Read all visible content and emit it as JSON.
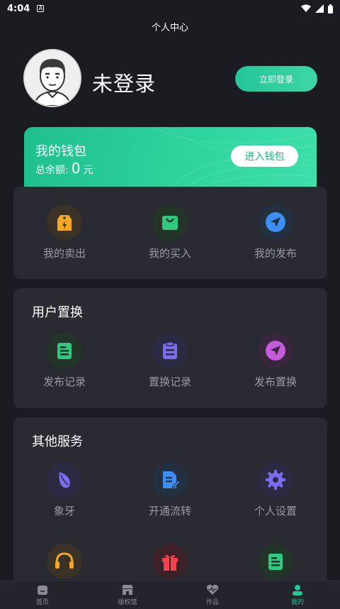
{
  "status": {
    "time": "4:04",
    "notification_icon": "A"
  },
  "header": {
    "title": "个人中心"
  },
  "profile": {
    "name": "未登录",
    "login_label": "立即登录"
  },
  "wallet": {
    "title": "我的钱包",
    "balance_label": "总余额:",
    "balance_value": "0",
    "balance_unit": "元",
    "enter_label": "进入钱包"
  },
  "orders": {
    "items": [
      {
        "label": "我的卖出",
        "icon": "price-tag-icon",
        "color": "#f5a623"
      },
      {
        "label": "我的买入",
        "icon": "shopping-bag-icon",
        "color": "#2ec97f"
      },
      {
        "label": "我的发布",
        "icon": "send-arrow-icon",
        "color": "#3d8ff5"
      }
    ]
  },
  "exchange": {
    "title": "用户置换",
    "items": [
      {
        "label": "发布记录",
        "icon": "document-icon",
        "color": "#2ec97f"
      },
      {
        "label": "置换记录",
        "icon": "clipboard-icon",
        "color": "#7b6cf0"
      },
      {
        "label": "发布置换",
        "icon": "send-arrow-icon",
        "color": "#c45bd9"
      }
    ]
  },
  "services": {
    "title": "其他服务",
    "items": [
      {
        "label": "象牙",
        "icon": "leaf-icon",
        "color": "#7b6cf0"
      },
      {
        "label": "开通流转",
        "icon": "edit-document-icon",
        "color": "#3d8ff5"
      },
      {
        "label": "个人设置",
        "icon": "gear-icon",
        "color": "#7b6cf0"
      },
      {
        "label": "",
        "icon": "headset-icon",
        "color": "#f5a623"
      },
      {
        "label": "",
        "icon": "gift-icon",
        "color": "#f2434f"
      },
      {
        "label": "",
        "icon": "document-icon",
        "color": "#2ec97f"
      }
    ]
  },
  "nav": {
    "items": [
      {
        "label": "首页",
        "icon": "home-icon",
        "active": false
      },
      {
        "label": "版权馆",
        "icon": "store-icon",
        "active": false
      },
      {
        "label": "作品",
        "icon": "heart-pulse-icon",
        "active": false
      },
      {
        "label": "我的",
        "icon": "user-icon",
        "active": true
      }
    ]
  }
}
